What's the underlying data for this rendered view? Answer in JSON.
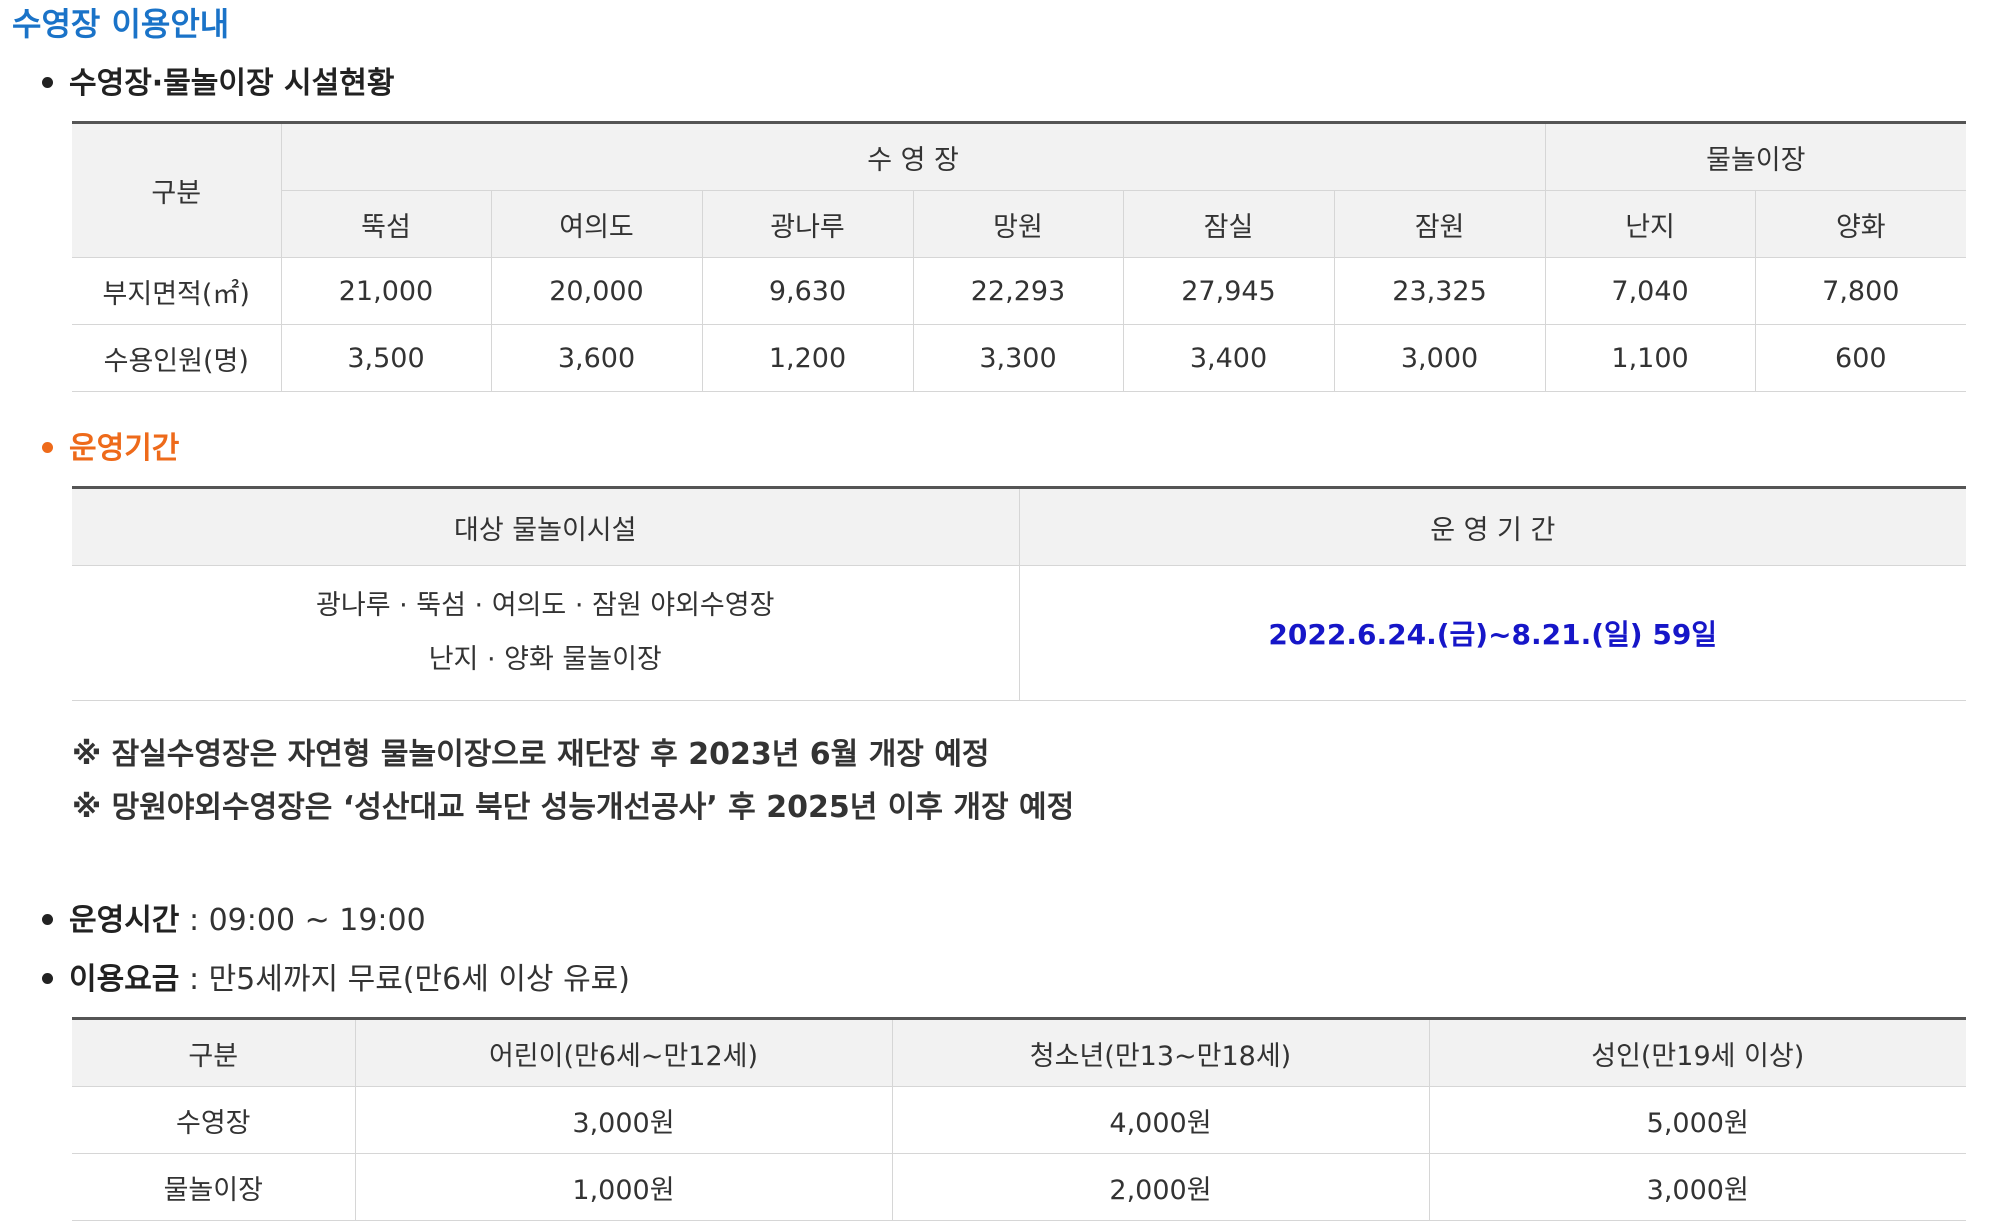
{
  "page_title": "수영장 이용안내",
  "section1": {
    "heading": "수영장·물놀이장 시설현황",
    "table": {
      "row_header": "구분",
      "group_pool": "수 영 장",
      "group_water": "물놀이장",
      "columns": [
        "뚝섬",
        "여의도",
        "광나루",
        "망원",
        "잠실",
        "잠원",
        "난지",
        "양화"
      ],
      "rows": [
        {
          "label": "부지면적(㎡)",
          "values": [
            "21,000",
            "20,000",
            "9,630",
            "22,293",
            "27,945",
            "23,325",
            "7,040",
            "7,800"
          ]
        },
        {
          "label": "수용인원(명)",
          "values": [
            "3,500",
            "3,600",
            "1,200",
            "3,300",
            "3,400",
            "3,000",
            "1,100",
            "600"
          ]
        }
      ]
    }
  },
  "section2": {
    "heading": "운영기간",
    "table": {
      "col1_header": "대상 물놀이시설",
      "col2_header": "운 영 기 간",
      "facility_line1": "광나루 · 뚝섬 · 여의도 · 잠원 야외수영장",
      "facility_line2": "난지 · 양화 물놀이장",
      "period": "2022.6.24.(금)~8.21.(일) 59일"
    }
  },
  "notes": [
    "※ 잠실수영장은 자연형 물놀이장으로 재단장 후 2023년 6월 개장 예정",
    "※ 망원야외수영장은 ‘성산대교 북단 성능개선공사’ 후 2025년 이후 개장 예정"
  ],
  "section3": {
    "heading": "운영시간",
    "text": " : 09:00 ~ 19:00"
  },
  "section4": {
    "heading": "이용요금",
    "text": " : 만5세까지 무료(만6세 이상 유료)",
    "table": {
      "headers": [
        "구분",
        "어린이(만6세~만12세)",
        "청소년(만13~만18세)",
        "성인(만19세 이상)"
      ],
      "rows": [
        {
          "label": "수영장",
          "values": [
            "3,000원",
            "4,000원",
            "5,000원"
          ]
        },
        {
          "label": "물놀이장",
          "values": [
            "1,000원",
            "2,000원",
            "3,000원"
          ]
        }
      ]
    }
  },
  "colors": {
    "title_blue": "#1a73c8",
    "accent_orange": "#ee6a1a",
    "period_blue": "#1616c8",
    "header_bg": "#f2f2f2"
  }
}
